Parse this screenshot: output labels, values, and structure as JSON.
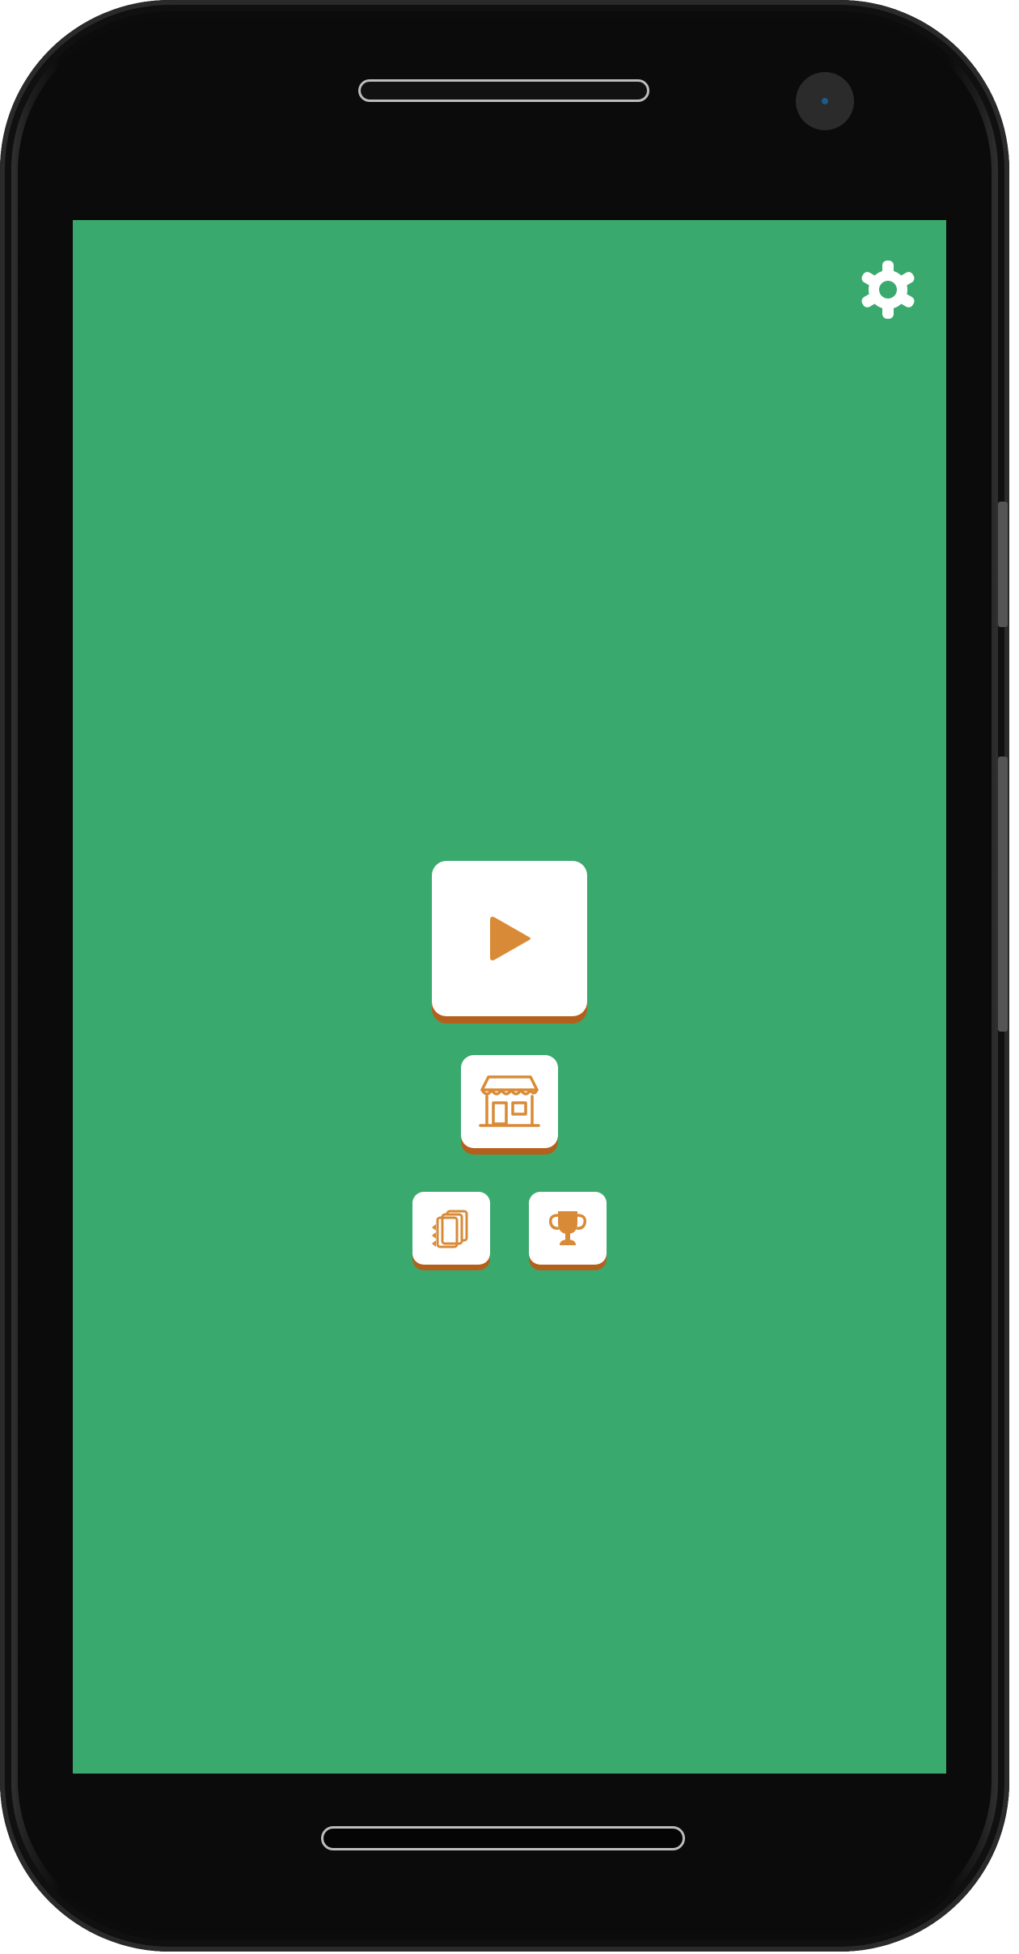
{
  "theme": {
    "screen_background": "#3aa96d",
    "tile_background": "#ffffff",
    "icon_color": "#d98a36",
    "tile_shadow": "#b4601d",
    "settings_icon_color": "#ffffff"
  },
  "menu": {
    "settings": {
      "icon": "gear-icon"
    },
    "play": {
      "icon": "play-icon"
    },
    "shop": {
      "icon": "shop-icon"
    },
    "collection": {
      "icon": "cards-icon"
    },
    "achievements": {
      "icon": "trophy-icon"
    }
  }
}
